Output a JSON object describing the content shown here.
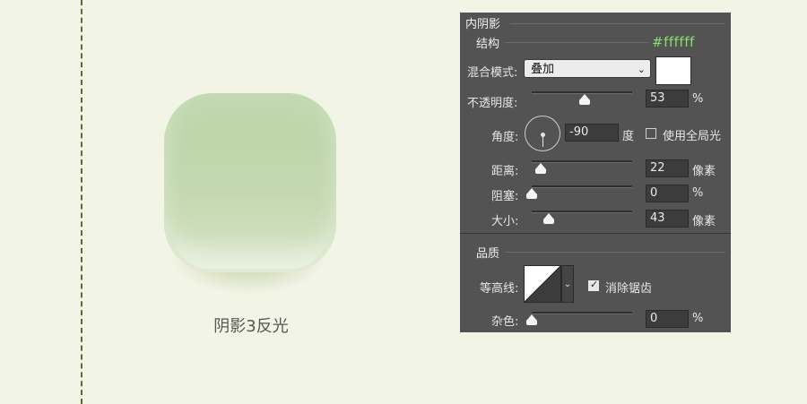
{
  "canvas": {
    "caption": "阴影3反光"
  },
  "panel": {
    "title": "内阴影",
    "structure": {
      "title": "结构",
      "hex_annotation": "#ffffff",
      "blend_mode_label": "混合模式:",
      "blend_mode_value": "叠加",
      "color_swatch": "#ffffff",
      "opacity_label": "不透明度:",
      "opacity_value": "53",
      "opacity_unit": "%",
      "angle_label": "角度:",
      "angle_value": "-90",
      "angle_unit": "度",
      "global_light_label": "使用全局光",
      "global_light_checked": false,
      "distance_label": "距离:",
      "distance_value": "22",
      "distance_unit": "像素",
      "choke_label": "阻塞:",
      "choke_value": "0",
      "choke_unit": "%",
      "size_label": "大小:",
      "size_value": "43",
      "size_unit": "像素"
    },
    "quality": {
      "title": "品质",
      "contour_label": "等高线:",
      "anti_alias_label": "消除锯齿",
      "anti_alias_checked": true,
      "noise_label": "杂色:",
      "noise_value": "0",
      "noise_unit": "%"
    }
  },
  "colors": {
    "background": "#f2f4e6",
    "icon": "#c0d6ab",
    "panel": "#535353",
    "hex_annotation": "#86e06a"
  }
}
